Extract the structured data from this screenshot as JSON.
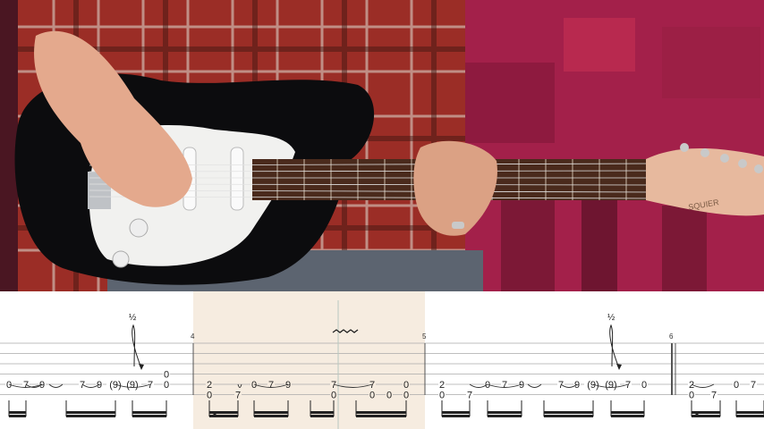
{
  "video": {
    "guitar_brand": "SQUIER"
  },
  "tab": {
    "measure_numbers": [
      "4",
      "5",
      "6"
    ],
    "bend_marks": [
      "½",
      "½"
    ],
    "colors": {
      "highlight": "#f6ece0",
      "staff_line": "#aaaaaa",
      "note": "#222222",
      "playhead": "#b8c8c0"
    },
    "m3_notes": [
      {
        "s": 5,
        "t": "0"
      },
      {
        "s": 5,
        "t": "7"
      },
      {
        "s": 5,
        "t": "9"
      },
      {
        "s": 5,
        "t": "7"
      },
      {
        "s": 5,
        "t": "9"
      },
      {
        "s": 5,
        "t": "(9)"
      },
      {
        "s": 5,
        "t": "(9)"
      },
      {
        "s": 5,
        "t": "7"
      },
      {
        "s": 5,
        "t": "0"
      },
      {
        "s": 4,
        "t": "0"
      }
    ],
    "m4_notes": [
      {
        "s": 5,
        "t": "2"
      },
      {
        "s": 6,
        "t": "0"
      },
      {
        "s": 6,
        "t": "7"
      },
      {
        "s": 5,
        "t": "0"
      },
      {
        "s": 5,
        "t": "7"
      },
      {
        "s": 5,
        "t": "9"
      },
      {
        "s": 5,
        "t": "7"
      },
      {
        "s": 6,
        "t": "0"
      },
      {
        "s": 5,
        "t": "7"
      },
      {
        "s": 6,
        "t": "0"
      },
      {
        "s": 6,
        "t": "0"
      },
      {
        "s": 5,
        "t": "0"
      },
      {
        "s": 6,
        "t": "0"
      }
    ],
    "m5_notes": [
      {
        "s": 5,
        "t": "2"
      },
      {
        "s": 6,
        "t": "0"
      },
      {
        "s": 6,
        "t": "7"
      },
      {
        "s": 5,
        "t": "0"
      },
      {
        "s": 5,
        "t": "7"
      },
      {
        "s": 5,
        "t": "9"
      },
      {
        "s": 5,
        "t": "7"
      },
      {
        "s": 5,
        "t": "9"
      },
      {
        "s": 5,
        "t": "(9)"
      },
      {
        "s": 5,
        "t": "(9)"
      },
      {
        "s": 5,
        "t": "7"
      },
      {
        "s": 5,
        "t": "0"
      }
    ],
    "m6_notes": [
      {
        "s": 5,
        "t": "2"
      },
      {
        "s": 6,
        "t": "0"
      },
      {
        "s": 6,
        "t": "7"
      },
      {
        "s": 5,
        "t": "0"
      },
      {
        "s": 5,
        "t": "7"
      }
    ]
  }
}
